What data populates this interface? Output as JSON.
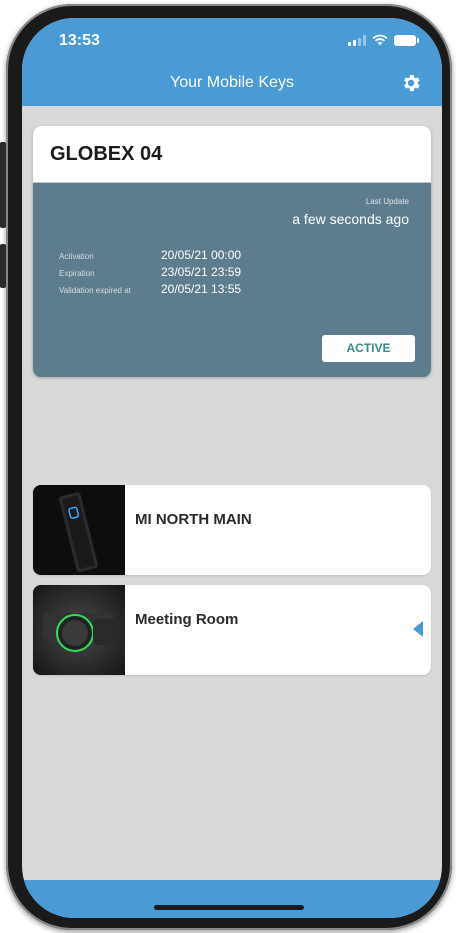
{
  "status_bar": {
    "time": "13:53"
  },
  "header": {
    "title": "Your Mobile Keys",
    "settings_icon": "gear-icon"
  },
  "key_card": {
    "title": "GLOBEX 04",
    "last_update_label": "Last Update",
    "last_update_value": "a few seconds ago",
    "details": [
      {
        "label": "Activation",
        "value": "20/05/21 00:00"
      },
      {
        "label": "Expiration",
        "value": "23/05/21 23:59"
      },
      {
        "label": "Validation expired at",
        "value": "20/05/21 13:55"
      }
    ],
    "status": "ACTIVE"
  },
  "locks": [
    {
      "name": "MI NORTH MAIN",
      "thumbnail": "wall-reader-image"
    },
    {
      "name": "Meeting Room",
      "thumbnail": "door-cylinder-image",
      "indicator": "chevron-left-icon"
    }
  ],
  "colors": {
    "accent": "#4a9ad6",
    "card": "#5d7d8f",
    "active_text": "#3a8a8c",
    "background": "#d9d9d9"
  }
}
